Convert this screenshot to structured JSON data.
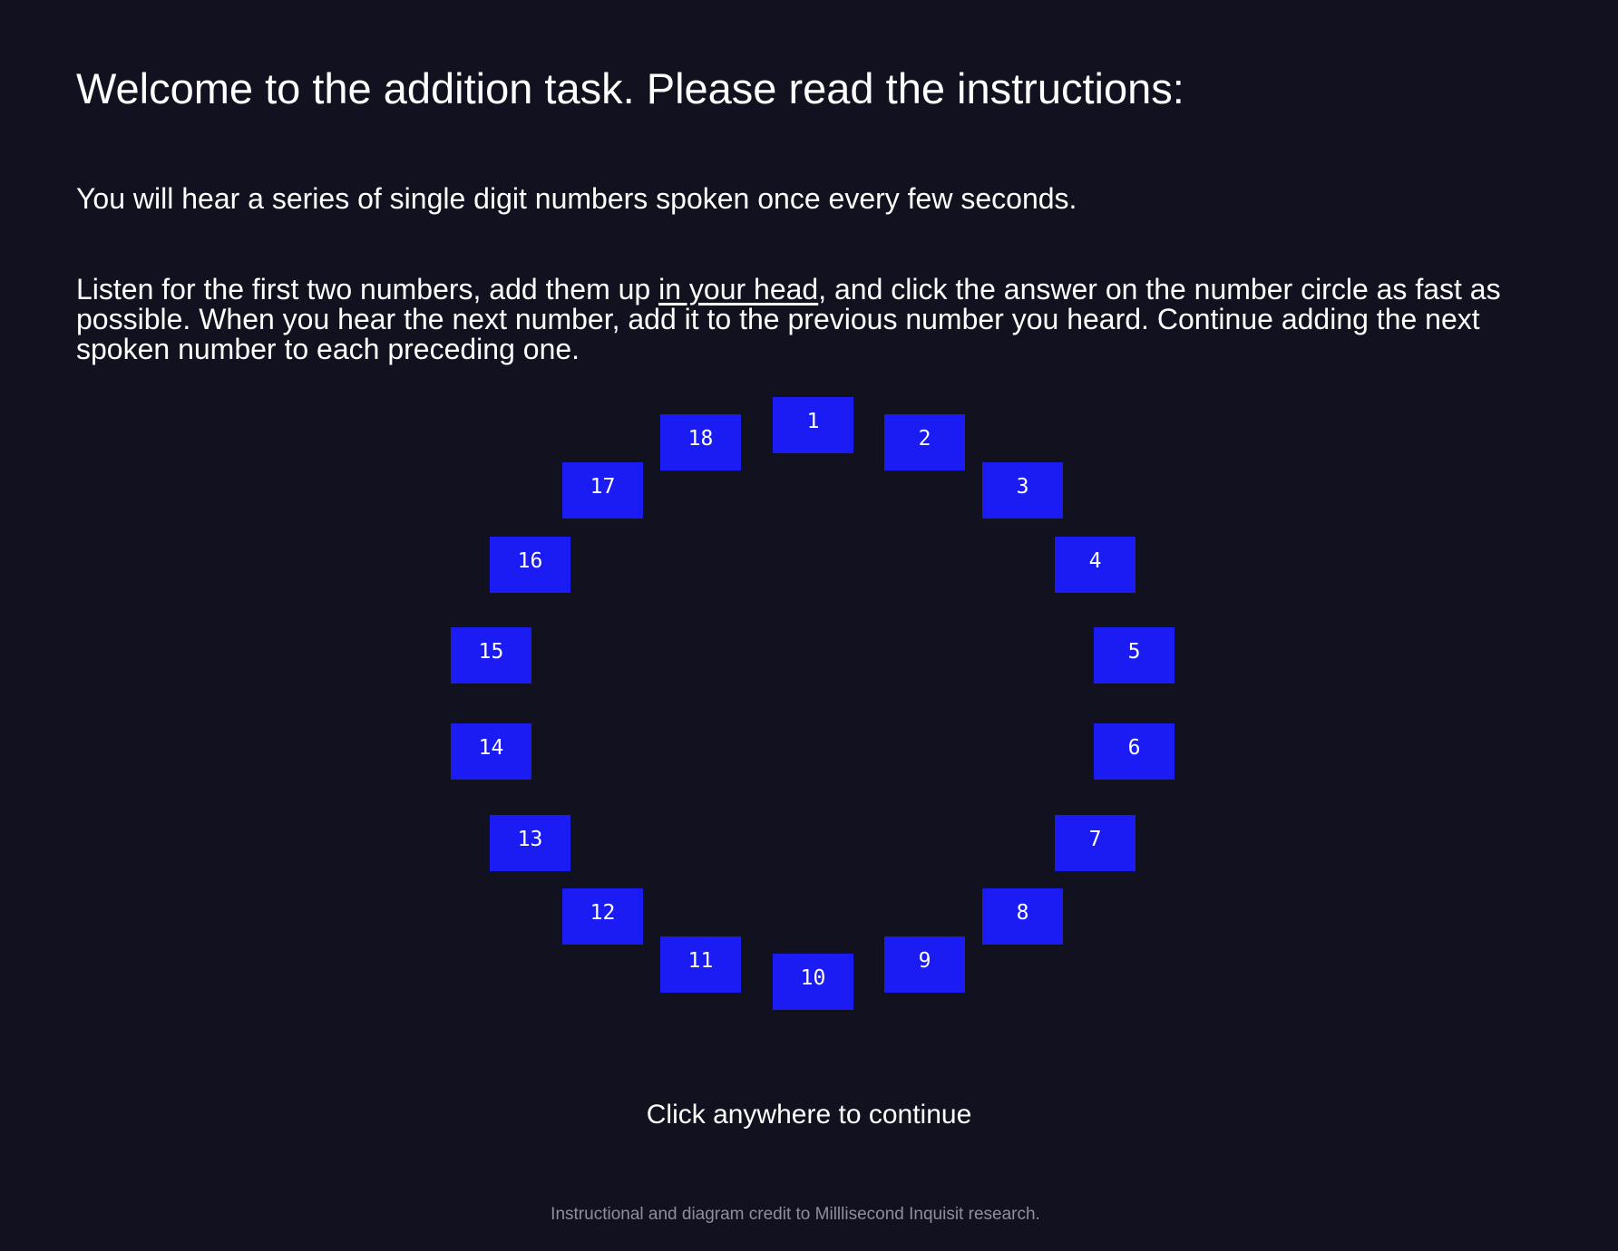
{
  "title": "Welcome to the addition task. Please read the instructions:",
  "instructions": {
    "para1": "You will hear a series of single digit numbers spoken once every few seconds.",
    "para2_before": "Listen for the first two numbers, add them up ",
    "para2_underlined": "in your head",
    "para2_after": ", and click the answer on the number circle as fast as possible. When you hear the next number, add it to the previous number you heard. Continue adding the next spoken number to each preceding one."
  },
  "number_circle": [
    "1",
    "2",
    "3",
    "4",
    "5",
    "6",
    "7",
    "8",
    "9",
    "10",
    "11",
    "12",
    "13",
    "14",
    "15",
    "16",
    "17",
    "18"
  ],
  "continue_text": "Click anywhere to continue",
  "credit": "Instructional and diagram credit to Milllisecond Inquisit research.",
  "colors": {
    "background": "#111120",
    "box": "#1a1cf3",
    "text": "#ffffff",
    "credit": "#8f8f9a"
  }
}
